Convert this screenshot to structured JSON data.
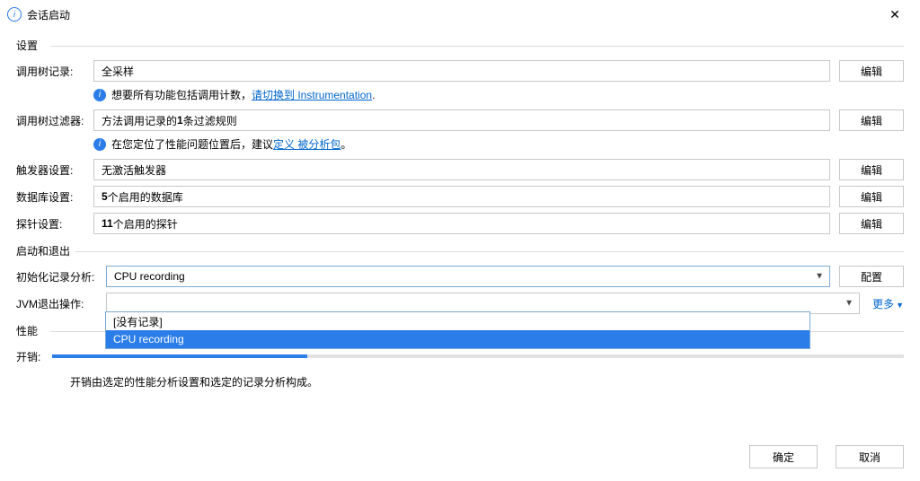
{
  "window": {
    "title": "会话启动"
  },
  "sections": {
    "settings": "设置",
    "startexit": "启动和退出",
    "perf": "性能"
  },
  "rows": {
    "callTree": {
      "label": "调用树记录:",
      "value": "全采样"
    },
    "filter": {
      "label": "调用树过滤器:",
      "value_prefix": "方法调用记录的",
      "value_bold": "1",
      "value_suffix": "条过滤规则"
    },
    "trigger": {
      "label": "触发器设置:",
      "value": "无激活触发器"
    },
    "database": {
      "label": "数据库设置:",
      "value_bold": "5",
      "value_suffix": "个启用的数据库"
    },
    "probe": {
      "label": "探针设置:",
      "value_bold": "11",
      "value_suffix": "个启用的探针"
    },
    "initRecord": {
      "label": "初始化记录分析:",
      "value": "CPU recording"
    },
    "jvmExit": {
      "label": "JVM退出操作:",
      "value": ""
    },
    "overhead": {
      "label": "开销:"
    }
  },
  "hints": {
    "h1_a": "想要所有功能包括调用计数，",
    "h1_link": "请切换到 Instrumentation",
    "h1_b": ".",
    "h2_a": "在您定位了性能问题位置后，建议",
    "h2_link": "定义 被分析包",
    "h2_b": "。"
  },
  "dropdown": {
    "options": [
      "[没有记录]",
      "CPU recording"
    ],
    "selectedIndex": 1
  },
  "buttons": {
    "edit": "编辑",
    "config": "配置",
    "more": "更多",
    "ok": "确定",
    "cancel": "取消"
  },
  "caption": "开销由选定的性能分析设置和选定的记录分析构成。",
  "perf": {
    "overhead_percent": 30
  }
}
